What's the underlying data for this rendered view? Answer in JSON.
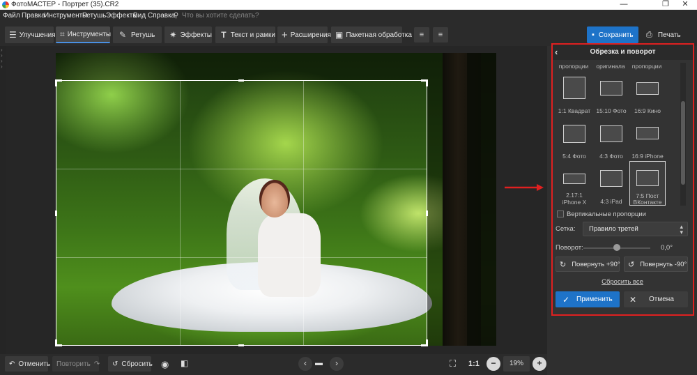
{
  "window": {
    "title": "ФотоМАСТЕР - Портрет (35).CR2",
    "min": "—",
    "max": "❐",
    "close": "✕"
  },
  "menu": {
    "items": [
      "Файл",
      "Правка",
      "Инструменты",
      "Ретушь",
      "Эффекты",
      "Вид",
      "Справка"
    ],
    "search_placeholder": "Что вы хотите сделать?"
  },
  "toolbar": {
    "tabs": [
      {
        "label": "Улучшения",
        "icon": "sliders-icon"
      },
      {
        "label": "Инструменты",
        "icon": "crop-icon",
        "active": true
      },
      {
        "label": "Ретушь",
        "icon": "brush-icon"
      },
      {
        "label": "Эффекты",
        "icon": "sparkle-icon"
      },
      {
        "label": "Текст и рамки",
        "icon": "text-icon"
      },
      {
        "label": "Расширения",
        "icon": "plus-icon"
      }
    ],
    "batch": "Пакетная обработка",
    "save": "Сохранить",
    "print": "Печать",
    "accent": "#1e73c8"
  },
  "panel": {
    "title": "Обрезка и поворот",
    "header_row": [
      "пропорции",
      "оригинала",
      "пропорции"
    ],
    "presets": [
      {
        "label": "1:1 Квадрат"
      },
      {
        "label": "15:10 Фото"
      },
      {
        "label": "16:9 Кино"
      },
      {
        "label": "5:4 Фото"
      },
      {
        "label": "4:3 Фото"
      },
      {
        "label": "16:9 iPhone"
      },
      {
        "label1": "2.17:1",
        "label2": "iPhone X"
      },
      {
        "label": "4:3 iPad"
      },
      {
        "label1": "7:5 Пост",
        "label2": "ВКонтакте",
        "selected": true
      }
    ],
    "vertical": "Вертикальные пропорции",
    "grid_label": "Сетка:",
    "grid_value": "Правило третей",
    "rotate_label": "Поворот:",
    "rotate_value": "0,0°",
    "rotate_fraction": 0.5,
    "rot_plus": "Повернуть +90°",
    "rot_minus": "Повернуть -90°",
    "reset_all": "Сбросить все",
    "apply": "Применить",
    "cancel": "Отмена",
    "highlight_color": "#e02020"
  },
  "bottom": {
    "undo": "Отменить",
    "redo": "Повторить",
    "reset": "Сбросить",
    "ratio": "1:1",
    "zoom": "19%"
  }
}
